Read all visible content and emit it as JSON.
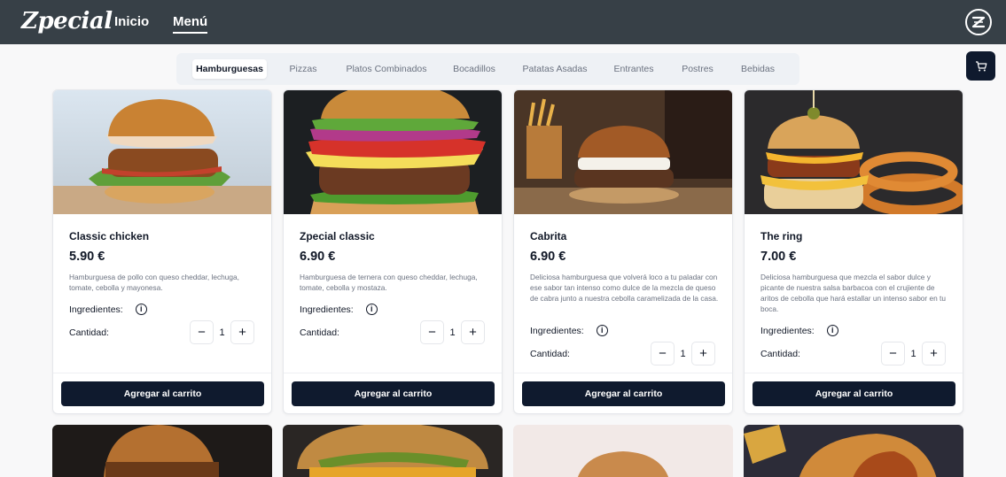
{
  "header": {
    "logo": "Zpecial",
    "nav": [
      {
        "label": "Inicio",
        "active": false
      },
      {
        "label": "Menú",
        "active": true
      }
    ],
    "badge_letter": "Z"
  },
  "tabs": [
    {
      "label": "Hamburguesas",
      "active": true
    },
    {
      "label": "Pizzas",
      "active": false
    },
    {
      "label": "Platos Combinados",
      "active": false
    },
    {
      "label": "Bocadillos",
      "active": false
    },
    {
      "label": "Patatas Asadas",
      "active": false
    },
    {
      "label": "Entrantes",
      "active": false
    },
    {
      "label": "Postres",
      "active": false
    },
    {
      "label": "Bebidas",
      "active": false
    }
  ],
  "cart_icon": "cart-icon",
  "labels": {
    "ingredients": "Ingredientes:",
    "quantity": "Cantidad:",
    "add_to_cart": "Agregar al carrito",
    "minus": "−",
    "plus": "+"
  },
  "products": [
    {
      "name": "Classic chicken",
      "price": "5.90 €",
      "description": "Hamburguesa de pollo con queso cheddar, lechuga, tomate, cebolla y mayonesa.",
      "quantity": "1"
    },
    {
      "name": "Zpecial classic",
      "price": "6.90 €",
      "description": "Hamburguesa de ternera con queso cheddar, lechuga, tomate, cebolla y mostaza.",
      "quantity": "1"
    },
    {
      "name": "Cabrita",
      "price": "6.90 €",
      "description": "Deliciosa hamburguesa que volverá loco a tu paladar con ese sabor tan intenso como dulce de la mezcla de queso de cabra junto a nuestra cebolla caramelizada de la casa.",
      "quantity": "1"
    },
    {
      "name": "The ring",
      "price": "7.00 €",
      "description": "Deliciosa hamburguesa que mezcla el sabor dulce y picante de nuestra salsa barbacoa con el crujiente de aritos de cebolla que hará estallar un intenso sabor en tu boca.",
      "quantity": "1"
    }
  ],
  "colors": {
    "header_bg": "#374047",
    "primary_dark": "#0f1a2e",
    "tabs_bg": "#eef1f5"
  }
}
